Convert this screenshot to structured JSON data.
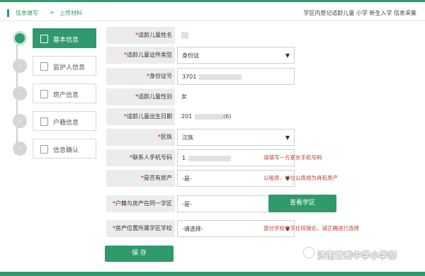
{
  "breadcrumb": {
    "first": "信息填写",
    "separator": ">",
    "second": "上传材料"
  },
  "top_right": "学区内登记适龄儿童  小学  新生入学  信息采集",
  "sidebar": {
    "items": [
      {
        "label": "基本信息",
        "icon": "document-icon",
        "active": true
      },
      {
        "label": "监护人信息",
        "icon": "user-card-icon",
        "active": false
      },
      {
        "label": "房产信息",
        "icon": "house-icon",
        "active": false
      },
      {
        "label": "户籍信息",
        "icon": "register-icon",
        "active": false
      },
      {
        "label": "信息确认",
        "icon": "hourglass-icon",
        "active": false
      }
    ]
  },
  "form": {
    "child_name": {
      "label": "适龄儿童姓名",
      "value": ""
    },
    "id_type": {
      "label": "适龄儿童证件类型",
      "value": "身份证"
    },
    "id_number": {
      "label": "身份证号",
      "value": "3701"
    },
    "gender": {
      "label": "适龄儿童性别",
      "value": "女"
    },
    "birth_date": {
      "label": "适龄儿童出生日期",
      "value": "201",
      "age": "(6)岁"
    },
    "ethnicity": {
      "label": "民族",
      "value": "汉族"
    },
    "contact_phone": {
      "label": "联系人手机号码",
      "value": "1",
      "hint": "请填写一方家长手机号码"
    },
    "has_property": {
      "label": "是否有房产",
      "value": "-是-",
      "hint": "公租房、单位公房视为具有房产"
    },
    "same_district": {
      "label": "户籍与房产在同一学区",
      "value": "-是-"
    },
    "school": {
      "label": "房产位置所属学区学校",
      "value": "-请选择-",
      "hint": "部分学校名字比较接近，请正确进行选择"
    }
  },
  "buttons": {
    "check_district": "查看学区",
    "save": "保 存"
  },
  "watermark": "济南育秀中学小学部",
  "colors": {
    "accent": "#2f9a6c",
    "hint": "#c0392b",
    "required": "#d0021b"
  }
}
